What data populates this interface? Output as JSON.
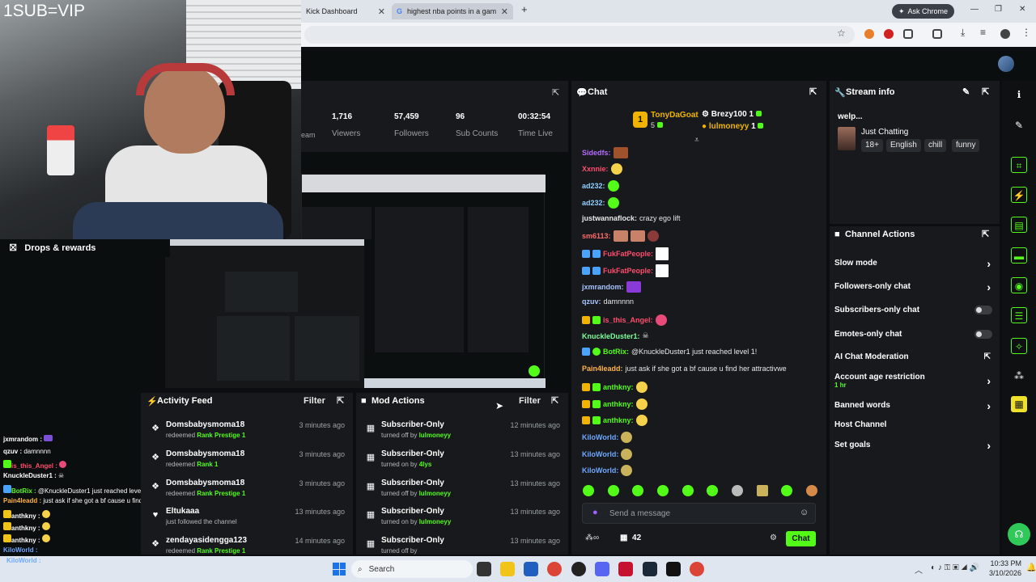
{
  "browser": {
    "tabs": [
      {
        "label": "Kick Dashboard"
      },
      {
        "label": "highest nba points in a game b"
      }
    ],
    "new_tab": "+",
    "ask_chrome": "Ask Chrome",
    "window_controls": {
      "min": "—",
      "max": "❐",
      "close": "✕"
    }
  },
  "webcam": {
    "overlay_text": "1SUB=VIP"
  },
  "drops": {
    "label": "Drops & rewards"
  },
  "stats": [
    {
      "value": "1,716",
      "label": "Viewers"
    },
    {
      "value": "57,459",
      "label": "Followers"
    },
    {
      "value": "96",
      "label": "Sub Counts"
    },
    {
      "value": "00:32:54",
      "label": "Time Live"
    }
  ],
  "stats_partial_label": "eam",
  "activity_feed": {
    "title": "Activity Feed",
    "filter": "Filter",
    "items": [
      {
        "name": "Domsbabysmoma18",
        "pre": "redeemed ",
        "highlight": "Rank Prestige 1",
        "time": "3 minutes ago",
        "icon": "gift-icon"
      },
      {
        "name": "Domsbabysmoma18",
        "pre": "redeemed ",
        "highlight": "Rank 1",
        "time": "3 minutes ago",
        "icon": "gift-icon"
      },
      {
        "name": "Domsbabysmoma18",
        "pre": "redeemed ",
        "highlight": "Rank Prestige 1",
        "time": "3 minutes ago",
        "icon": "gift-icon"
      },
      {
        "name": "Eltukaaa",
        "pre": "just followed the channel",
        "highlight": "",
        "time": "13 minutes ago",
        "icon": "heart-icon"
      },
      {
        "name": "zendayasidengga123",
        "pre": "redeemed ",
        "highlight": "Rank Prestige 1",
        "time": "14 minutes ago",
        "icon": "gift-icon"
      }
    ]
  },
  "mod_actions": {
    "title": "Mod Actions",
    "filter": "Filter",
    "items": [
      {
        "name": "Subscriber-Only",
        "pre": "turned off by ",
        "highlight": "lulmoneyy",
        "time": "12 minutes ago"
      },
      {
        "name": "Subscriber-Only",
        "pre": "turned on by ",
        "highlight": "4lys",
        "time": "13 minutes ago"
      },
      {
        "name": "Subscriber-Only",
        "pre": "turned off by ",
        "highlight": "lulmoneyy",
        "time": "13 minutes ago"
      },
      {
        "name": "Subscriber-Only",
        "pre": "turned on by ",
        "highlight": "lulmoneyy",
        "time": "13 minutes ago"
      },
      {
        "name": "Subscriber-Only",
        "pre": "turned off by ",
        "highlight": "",
        "time": "13 minutes ago"
      }
    ]
  },
  "chat": {
    "title": "Chat",
    "leaderboard": {
      "first": {
        "rank": "1",
        "name": "TonyDaGoat",
        "count": "5"
      },
      "second": {
        "name": "Brezy100",
        "count": "1"
      },
      "third": {
        "name": "lulmoneyy",
        "count": "1"
      }
    },
    "messages": [
      {
        "user": "Sidedfs:",
        "text": "",
        "color": "#b56cff"
      },
      {
        "user": "Xxnnie:",
        "text": "",
        "color": "#ff4d6d"
      },
      {
        "user": "ad232:",
        "text": "",
        "color": "#8fd0ff"
      },
      {
        "user": "ad232:",
        "text": "",
        "color": "#8fd0ff"
      },
      {
        "user": "justwannaflock:",
        "text": "crazy ego lift",
        "color": "#e8e8e8"
      },
      {
        "user": "sm6113:",
        "text": "",
        "color": "#ff6b6b"
      },
      {
        "user": "FukFatPeople:",
        "text": "",
        "color": "#ff4d6d"
      },
      {
        "user": "FukFatPeople:",
        "text": "",
        "color": "#ff4d6d"
      },
      {
        "user": "jxmrandom:",
        "text": "",
        "color": "#a9c4ff"
      },
      {
        "user": "qzuv:",
        "text": "damnnnn",
        "color": "#a9c4ff"
      },
      {
        "user": "is_this_Angel:",
        "text": "",
        "color": "#ff4d6d"
      },
      {
        "user": "KnuckleDuster1:",
        "text": "",
        "color": "#7dff9a"
      },
      {
        "user": "BotRix:",
        "text": "@KnuckleDuster1 just reached level 1!",
        "color": "#53fc18"
      },
      {
        "user": "Pain4leadd:",
        "text": "just ask if she got a bf cause u find her attractivwe",
        "color": "#ffb347"
      },
      {
        "user": "anthkny:",
        "text": "",
        "color": "#53fc18"
      },
      {
        "user": "anthkny:",
        "text": "",
        "color": "#53fc18"
      },
      {
        "user": "anthkny:",
        "text": "",
        "color": "#53fc18"
      },
      {
        "user": "KiloWorld:",
        "text": "",
        "color": "#6fa8ff"
      },
      {
        "user": "KiloWorld:",
        "text": "",
        "color": "#6fa8ff"
      },
      {
        "user": "KiloWorld:",
        "text": "",
        "color": "#6fa8ff"
      }
    ],
    "input_placeholder": "Send a message",
    "viewer_count": "42",
    "send": "Chat"
  },
  "stream_info": {
    "title": "Stream info",
    "stream_title": "welp...",
    "category": "Just Chatting",
    "tags": [
      "18+",
      "English",
      "chill",
      "funny"
    ]
  },
  "channel_actions": {
    "title": "Channel Actions",
    "rows": [
      {
        "label": "Slow mode",
        "control": "chevron"
      },
      {
        "label": "Followers-only chat",
        "control": "chevron"
      },
      {
        "label": "Subscribers-only chat",
        "control": "toggle"
      },
      {
        "label": "Emotes-only chat",
        "control": "toggle"
      },
      {
        "label": "AI Chat Moderation",
        "control": "link"
      },
      {
        "label": "Account age restriction",
        "sub": "1 hr",
        "control": "chevron"
      },
      {
        "label": "Banned words",
        "control": "chevron"
      },
      {
        "label": "Host Channel",
        "control": "none"
      },
      {
        "label": "Set goals",
        "control": "chevron"
      }
    ]
  },
  "overlay_chat": [
    {
      "user": "jxmrandom :",
      "text": ""
    },
    {
      "user": "qzuv :",
      "text": "damnnnn"
    },
    {
      "user": "is_this_Angel :",
      "text": ""
    },
    {
      "user": "KnuckleDuster1 :",
      "text": ""
    },
    {
      "user": "BotRix :",
      "text": "@KnuckleDuster1 just reached level 1!"
    },
    {
      "user": "Pain4leadd :",
      "text": "just ask if she got a bf cause u find her attractivwe"
    },
    {
      "user": "anthkny :",
      "text": ""
    },
    {
      "user": "anthkny :",
      "text": ""
    },
    {
      "user": "anthkny :",
      "text": ""
    },
    {
      "user": "KiloWorld :",
      "text": ""
    }
  ],
  "taskbar": {
    "search": "Search",
    "time": "10:33 PM",
    "date": "3/10/2026"
  },
  "colors": {
    "kick_green": "#53fc18",
    "panel": "#17191c",
    "bg": "#0b0e0f"
  }
}
